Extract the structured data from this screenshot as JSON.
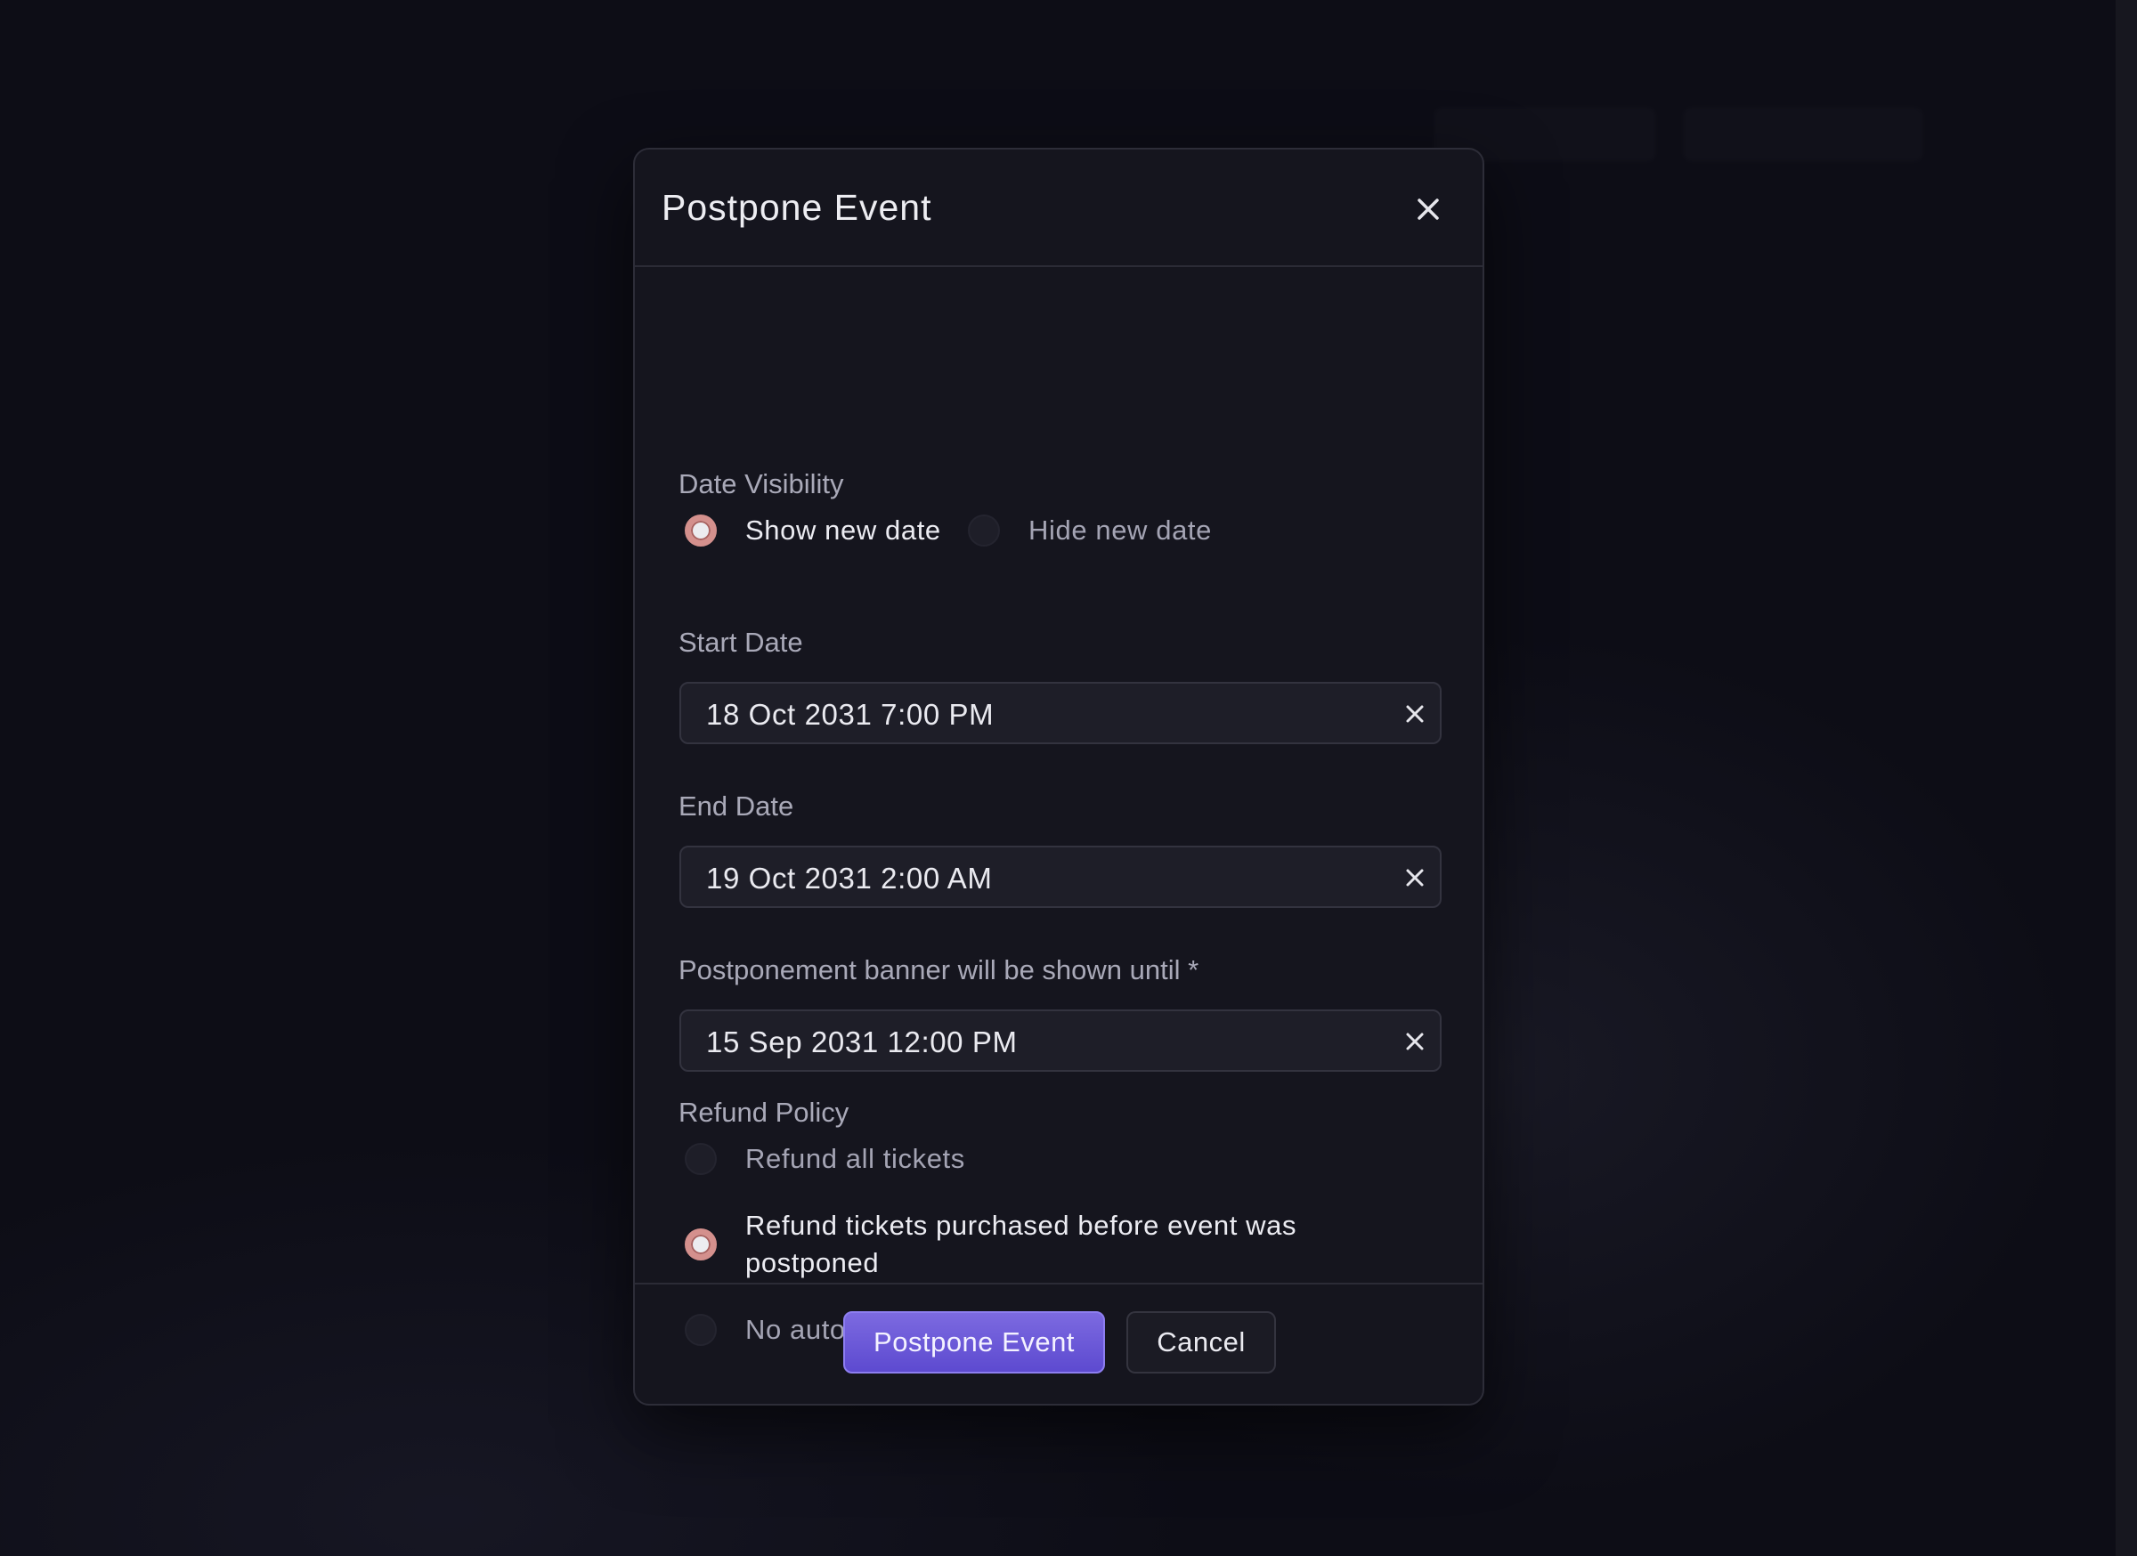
{
  "modal": {
    "title": "Postpone Event",
    "date_visibility": {
      "label": "Date Visibility",
      "options": [
        {
          "label": "Show new date",
          "selected": true
        },
        {
          "label": "Hide new date",
          "selected": false
        }
      ]
    },
    "start_date": {
      "label": "Start Date",
      "value": "18 Oct 2031 7:00 PM"
    },
    "end_date": {
      "label": "End Date",
      "value": "19 Oct 2031 2:00 AM"
    },
    "banner_until": {
      "label": "Postponement banner will be shown until *",
      "value": "15 Sep 2031 12:00 PM"
    },
    "refund_policy": {
      "label": "Refund Policy",
      "options": [
        {
          "label": "Refund all tickets",
          "selected": false
        },
        {
          "label": "Refund tickets purchased before event was postponed",
          "selected": true
        },
        {
          "label": "No automatic refunds",
          "selected": false
        }
      ]
    },
    "footer": {
      "primary_label": "Postpone Event",
      "cancel_label": "Cancel"
    }
  },
  "colors": {
    "accent": "#6a58d8",
    "radio_selected_ring": "#d4908d",
    "background": "#0d0d16",
    "modal_bg": "#15151e"
  },
  "icons": {
    "close": "close-icon",
    "clear": "clear-icon"
  }
}
